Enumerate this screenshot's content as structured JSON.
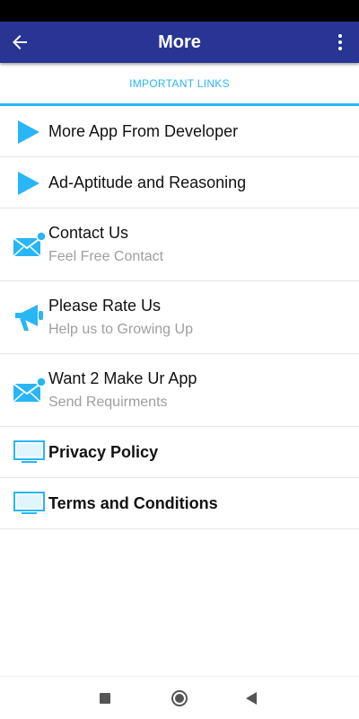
{
  "app_bar": {
    "title": "More",
    "background": "#283593",
    "back_icon": "arrow-left-icon",
    "menu_icon": "more-vertical-icon"
  },
  "section": {
    "header": "IMPORTANT LINKS",
    "accent": "#29b6f6"
  },
  "items": [
    {
      "title": "More App From Developer",
      "icon": "play-icon"
    },
    {
      "title": "Ad-Aptitude and Reasoning",
      "icon": "play-icon"
    },
    {
      "title": "Contact Us",
      "subtitle": "Feel Free Contact",
      "icon": "mail-notification-icon"
    },
    {
      "title": "Please Rate Us",
      "subtitle": "Help us to Growing Up",
      "icon": "megaphone-icon"
    },
    {
      "title": "Want 2 Make Ur App",
      "subtitle": "Send Requirments",
      "icon": "mail-notification-icon"
    },
    {
      "title": "Privacy Policy",
      "icon": "monitor-icon"
    },
    {
      "title": "Terms and Conditions",
      "icon": "monitor-icon"
    }
  ],
  "nav_bar": {
    "recents_icon": "square-icon",
    "home_icon": "circle-icon",
    "back_icon": "triangle-back-icon"
  }
}
